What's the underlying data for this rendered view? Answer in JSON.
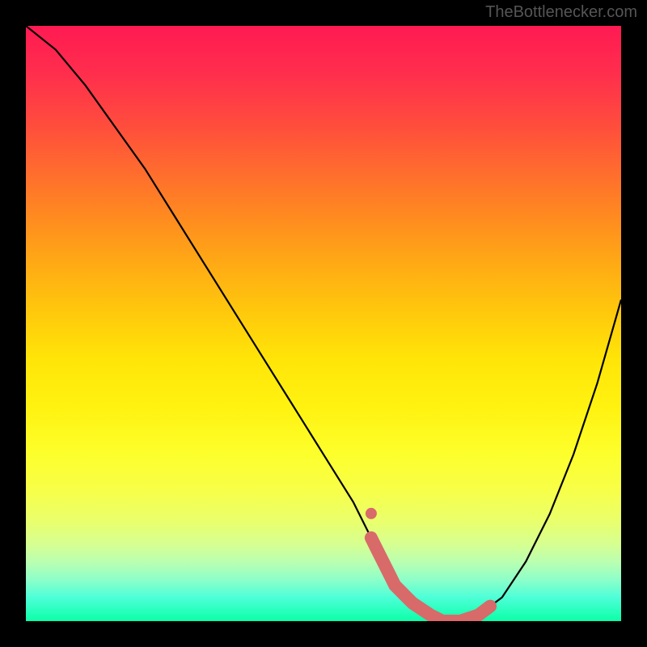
{
  "watermark": "TheBottlenecker.com",
  "chart_data": {
    "type": "line",
    "title": "",
    "xlabel": "",
    "ylabel": "",
    "xlim": [
      0,
      100
    ],
    "ylim": [
      0,
      100
    ],
    "series": [
      {
        "name": "bottleneck-curve",
        "x": [
          0,
          5,
          10,
          15,
          20,
          25,
          30,
          35,
          40,
          45,
          50,
          55,
          58,
          60,
          62,
          65,
          68,
          70,
          73,
          76,
          80,
          84,
          88,
          92,
          96,
          100
        ],
        "y": [
          100,
          96,
          90,
          83,
          76,
          68,
          60,
          52,
          44,
          36,
          28,
          20,
          14,
          10,
          6,
          3,
          1,
          0,
          0,
          1,
          4,
          10,
          18,
          28,
          40,
          54
        ]
      }
    ],
    "highlight": {
      "flat_region_x": [
        58,
        78
      ],
      "marker_x": 58
    },
    "background_gradient": {
      "top": "#ff1a52",
      "mid": "#ffe010",
      "bottom": "#0cffa8"
    }
  }
}
